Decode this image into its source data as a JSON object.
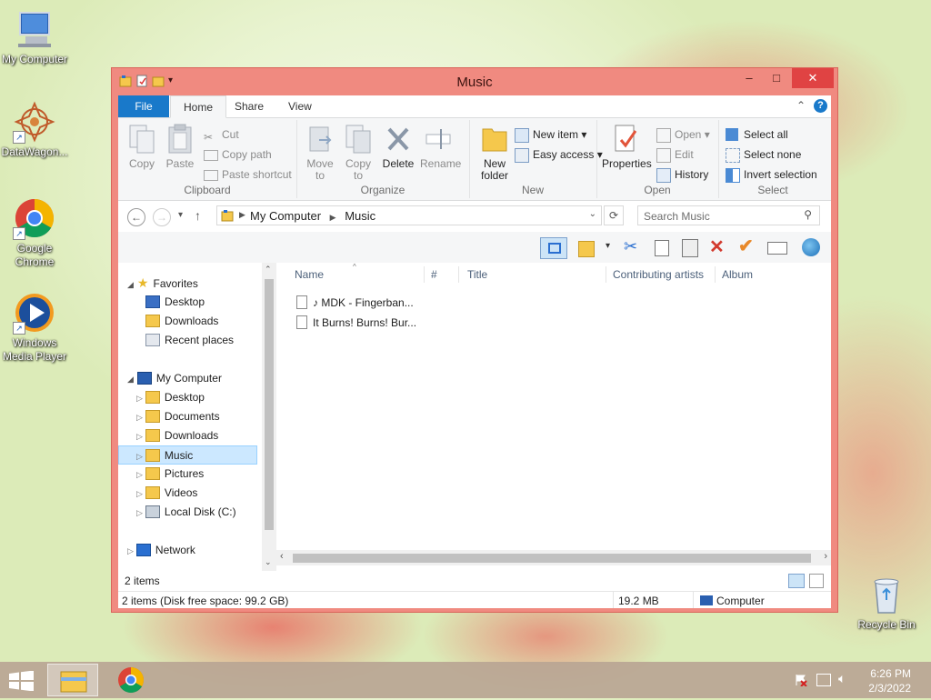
{
  "desktop": {
    "icons": [
      {
        "label": "My Computer",
        "icon": "computer-icon"
      },
      {
        "label": "DataWagon...",
        "icon": "datawagon-icon"
      },
      {
        "label": "Google Chrome",
        "icon": "chrome-icon"
      },
      {
        "label": "Windows Media Player",
        "icon": "media-player-icon"
      },
      {
        "label": "Recycle Bin",
        "icon": "recycle-bin-icon"
      }
    ]
  },
  "window": {
    "title": "Music",
    "minimize": "–",
    "maximize": "□",
    "close": "✕"
  },
  "ribbon": {
    "tabs": {
      "file": "File",
      "home": "Home",
      "share": "Share",
      "view": "View"
    },
    "clipboard": {
      "label": "Clipboard",
      "copy": "Copy",
      "paste": "Paste",
      "cut": "Cut",
      "copy_path": "Copy path",
      "paste_shortcut": "Paste shortcut"
    },
    "organize": {
      "label": "Organize",
      "move_to": "Move to",
      "copy_to": "Copy to",
      "delete": "Delete",
      "rename": "Rename"
    },
    "new": {
      "label": "New",
      "new_folder": "New folder",
      "new_item": "New item",
      "easy_access": "Easy access"
    },
    "open": {
      "label": "Open",
      "properties": "Properties",
      "open": "Open",
      "edit": "Edit",
      "history": "History"
    },
    "select": {
      "label": "Select",
      "select_all": "Select all",
      "select_none": "Select none",
      "invert": "Invert selection"
    }
  },
  "address": {
    "crumbs": [
      "My Computer",
      "Music"
    ],
    "search_placeholder": "Search Music"
  },
  "navpane": {
    "favorites": "Favorites",
    "fav_items": [
      "Desktop",
      "Downloads",
      "Recent places"
    ],
    "computer": "My Computer",
    "computer_items": [
      "Desktop",
      "Documents",
      "Downloads",
      "Music",
      "Pictures",
      "Videos",
      "Local Disk (C:)"
    ],
    "network": "Network"
  },
  "columns": [
    "Name",
    "#",
    "Title",
    "Contributing artists",
    "Album"
  ],
  "files": [
    {
      "name": "♪ MDK - Fingerban..."
    },
    {
      "name": "It Burns! Burns! Bur..."
    }
  ],
  "status": {
    "item_count": "2 items",
    "details_left": "2 items (Disk free space: 99.2 GB)",
    "size": "19.2 MB",
    "location": "Computer"
  },
  "taskbar": {
    "time": "6:26 PM",
    "date": "2/3/2022"
  },
  "colors": {
    "window_frame": "#f08a80",
    "file_tab": "#1979ca",
    "selection": "#cce8ff",
    "close_button": "#e04343"
  }
}
